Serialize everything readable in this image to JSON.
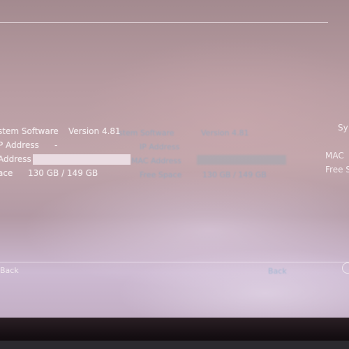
{
  "system_info": {
    "rows": [
      {
        "label": "stem Software",
        "value": "Version 4.81"
      },
      {
        "label": "P Address",
        "value": "-"
      },
      {
        "label": "Address",
        "value": ""
      },
      {
        "label": "ace",
        "value": "130 GB / 149 GB"
      }
    ]
  },
  "right_panel": {
    "labels": [
      "Sy",
      "MAC",
      "Free S"
    ]
  },
  "reflection": {
    "rows": [
      {
        "label": "stem Software",
        "value": "Version 4.81"
      },
      {
        "label": "IP Address",
        "value": ""
      },
      {
        "label": "MAC Address",
        "value": ""
      },
      {
        "label": "Free Space",
        "value": "130 GB / 149 GB"
      }
    ],
    "footer": "Back"
  },
  "footer": {
    "back_label": "Back",
    "back_icon": "circle-icon"
  },
  "colors": {
    "text": "#f5eef0",
    "background": "#b89ca2",
    "rule": "#f5ebf0"
  }
}
